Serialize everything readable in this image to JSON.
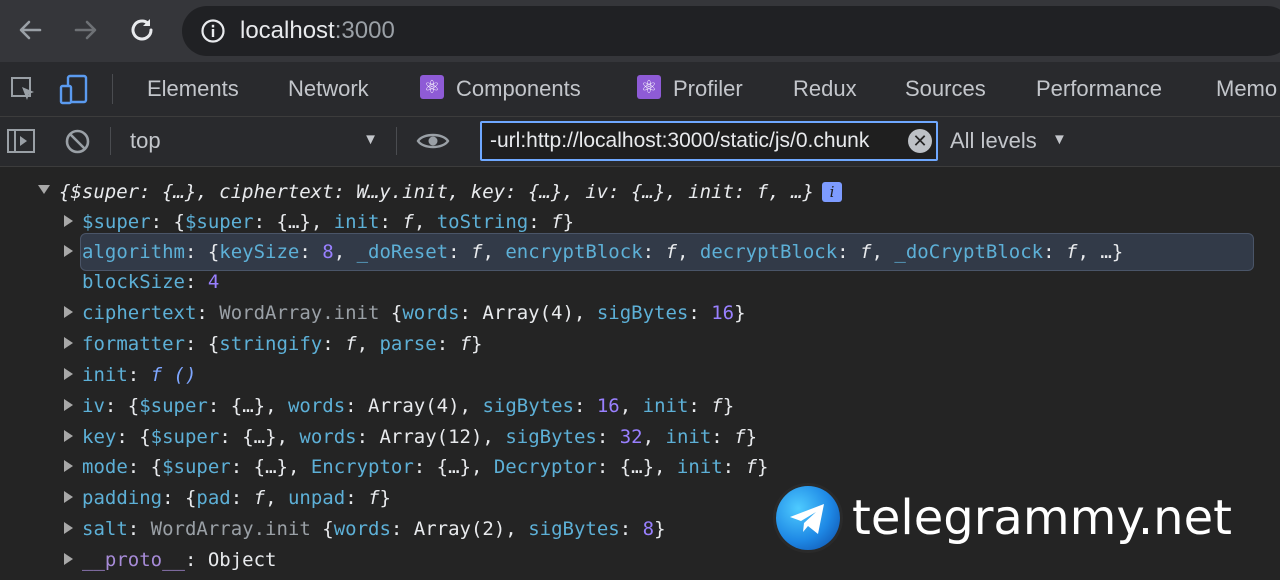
{
  "browser": {
    "url_host": "localhost",
    "url_port": ":3000"
  },
  "devtools": {
    "tabs": [
      {
        "label": "Elements"
      },
      {
        "label": "Network"
      },
      {
        "label": "Components",
        "icon": "react-icon"
      },
      {
        "label": "Profiler",
        "icon": "react-icon"
      },
      {
        "label": "Redux"
      },
      {
        "label": "Sources"
      },
      {
        "label": "Performance"
      },
      {
        "label": "Memo"
      }
    ],
    "context": "top",
    "filter_value": "-url:http://localhost:3000/static/js/0.chunk",
    "levels": "All levels"
  },
  "console": {
    "summary": "{$super: {…}, ciphertext: W…y.init, key: {…}, iv: {…}, init: f, …}",
    "info_badge": "i",
    "rows": [
      {
        "key": "$super",
        "rest": "{$super: {…}, init: f, toString: f}"
      },
      {
        "key": "algorithm",
        "rest": "{keySize: 8, _doReset: f, encryptBlock: f, decryptBlock: f, _doCryptBlock: f, …}"
      },
      {
        "key": "blockSize",
        "rest": "4"
      },
      {
        "key": "ciphertext",
        "rest_dim": "WordArray.init",
        "rest": "{words: Array(4), sigBytes: 16}"
      },
      {
        "key": "formatter",
        "rest": "{stringify: f, parse: f}"
      },
      {
        "key": "init",
        "rest": "f ()"
      },
      {
        "key": "iv",
        "rest": "{$super: {…}, words: Array(4), sigBytes: 16, init: f}"
      },
      {
        "key": "key",
        "rest": "{$super: {…}, words: Array(12), sigBytes: 32, init: f}"
      },
      {
        "key": "mode",
        "rest": "{$super: {…}, Encryptor: {…}, Decryptor: {…}, init: f}"
      },
      {
        "key": "padding",
        "rest": "{pad: f, unpad: f}"
      },
      {
        "key": "salt",
        "rest_dim": "WordArray.init",
        "rest": "{words: Array(2), sigBytes: 8}"
      },
      {
        "key": "__proto__",
        "rest": "Object"
      }
    ]
  },
  "watermark": "telegrammy.net"
}
